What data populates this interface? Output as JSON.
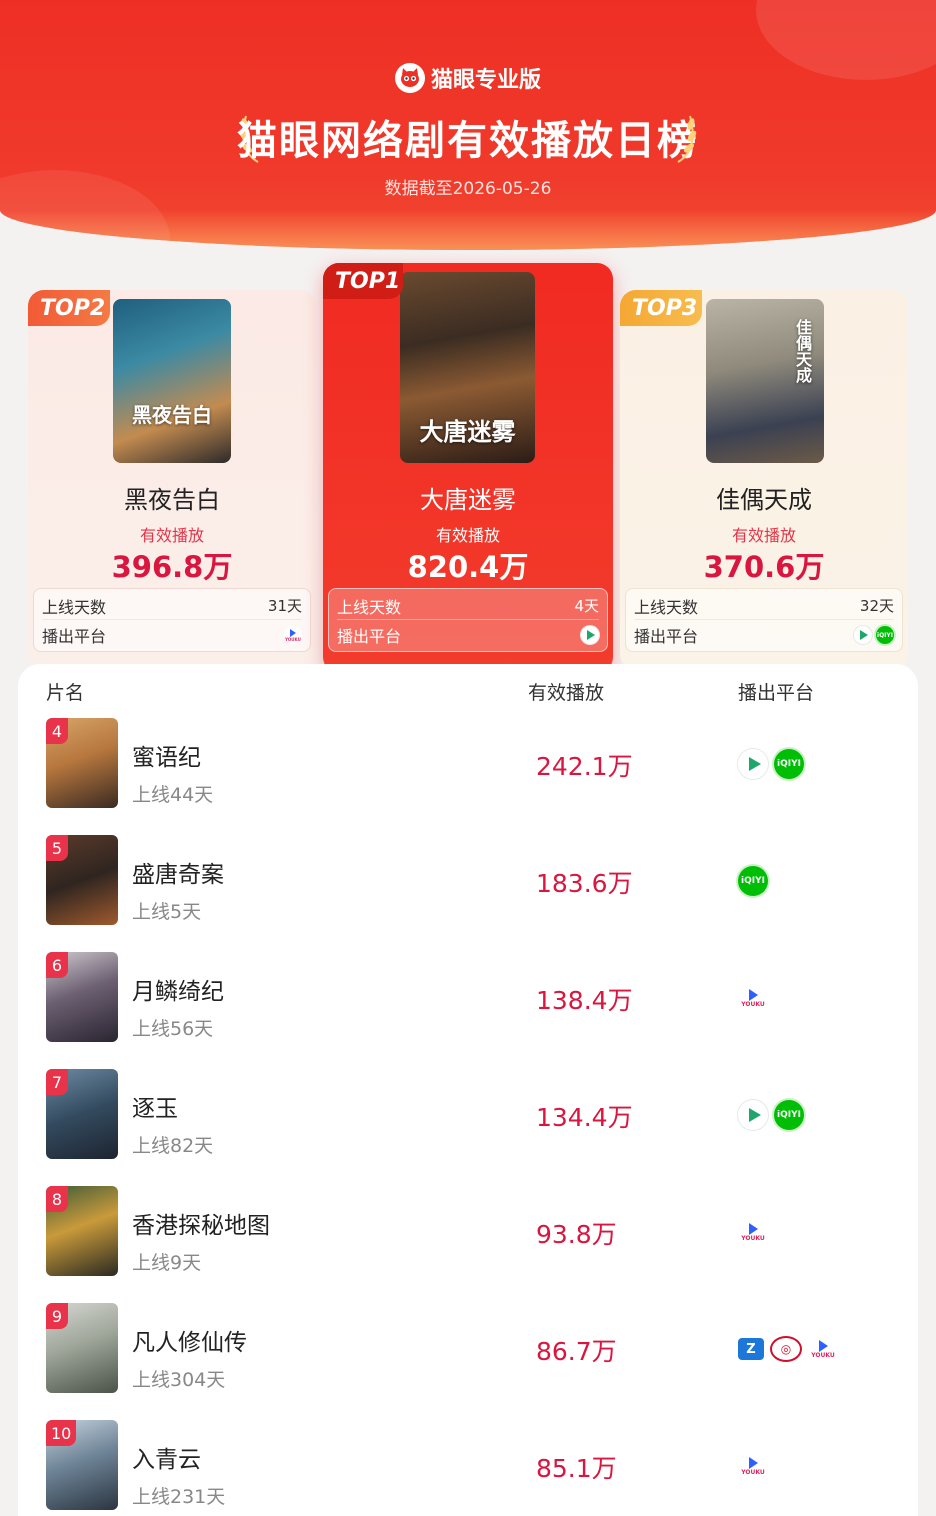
{
  "header": {
    "brand": "猫眼专业版",
    "title": "猫眼网络剧有效播放日榜",
    "date": "数据截至2026-05-26"
  },
  "podium": [
    {
      "rank_tag": "TOP2",
      "name": "黑夜告白",
      "poster_text": "黑夜告白",
      "play_label": "有效播放",
      "play": "396.8万",
      "days_label": "上线天数",
      "days": "31天",
      "platform_label": "播出平台",
      "platforms": [
        "youku-icon"
      ]
    },
    {
      "rank_tag": "TOP1",
      "name": "大唐迷雾",
      "poster_text": "大唐迷雾",
      "play_label": "有效播放",
      "play": "820.4万",
      "days_label": "上线天数",
      "days": "4天",
      "platform_label": "播出平台",
      "platforms": [
        "tencent-video-icon"
      ]
    },
    {
      "rank_tag": "TOP3",
      "name": "佳偶天成",
      "poster_text": "佳偶天成",
      "play_label": "有效播放",
      "play": "370.6万",
      "days_label": "上线天数",
      "days": "32天",
      "platform_label": "播出平台",
      "platforms": [
        "tencent-video-icon",
        "iqiyi-icon"
      ]
    }
  ],
  "list": {
    "headers": {
      "name": "片名",
      "play": "有效播放",
      "platform": "播出平台"
    },
    "rows": [
      {
        "rank": "4",
        "title": "蜜语纪",
        "days": "上线44天",
        "play": "242.1万",
        "platforms": [
          "tencent-video-icon",
          "iqiyi-icon"
        ]
      },
      {
        "rank": "5",
        "title": "盛唐奇案",
        "days": "上线5天",
        "play": "183.6万",
        "platforms": [
          "iqiyi-icon"
        ]
      },
      {
        "rank": "6",
        "title": "月鳞绮纪",
        "days": "上线56天",
        "play": "138.4万",
        "platforms": [
          "youku-icon"
        ]
      },
      {
        "rank": "7",
        "title": "逐玉",
        "days": "上线82天",
        "play": "134.4万",
        "platforms": [
          "tencent-video-icon",
          "iqiyi-icon"
        ]
      },
      {
        "rank": "8",
        "title": "香港探秘地图",
        "days": "上线9天",
        "play": "93.8万",
        "platforms": [
          "youku-icon"
        ]
      },
      {
        "rank": "9",
        "title": "凡人修仙传",
        "days": "上线304天",
        "play": "86.7万",
        "platforms": [
          "zhejiang-tv-icon",
          "cctv-icon",
          "youku-icon"
        ]
      },
      {
        "rank": "10",
        "title": "入青云",
        "days": "上线231天",
        "play": "85.1万",
        "platforms": [
          "youku-icon"
        ]
      }
    ]
  },
  "colors": {
    "header_red": "#ee2f25",
    "accent_red": "#d9163f",
    "rank_badge": "#e8334a"
  }
}
